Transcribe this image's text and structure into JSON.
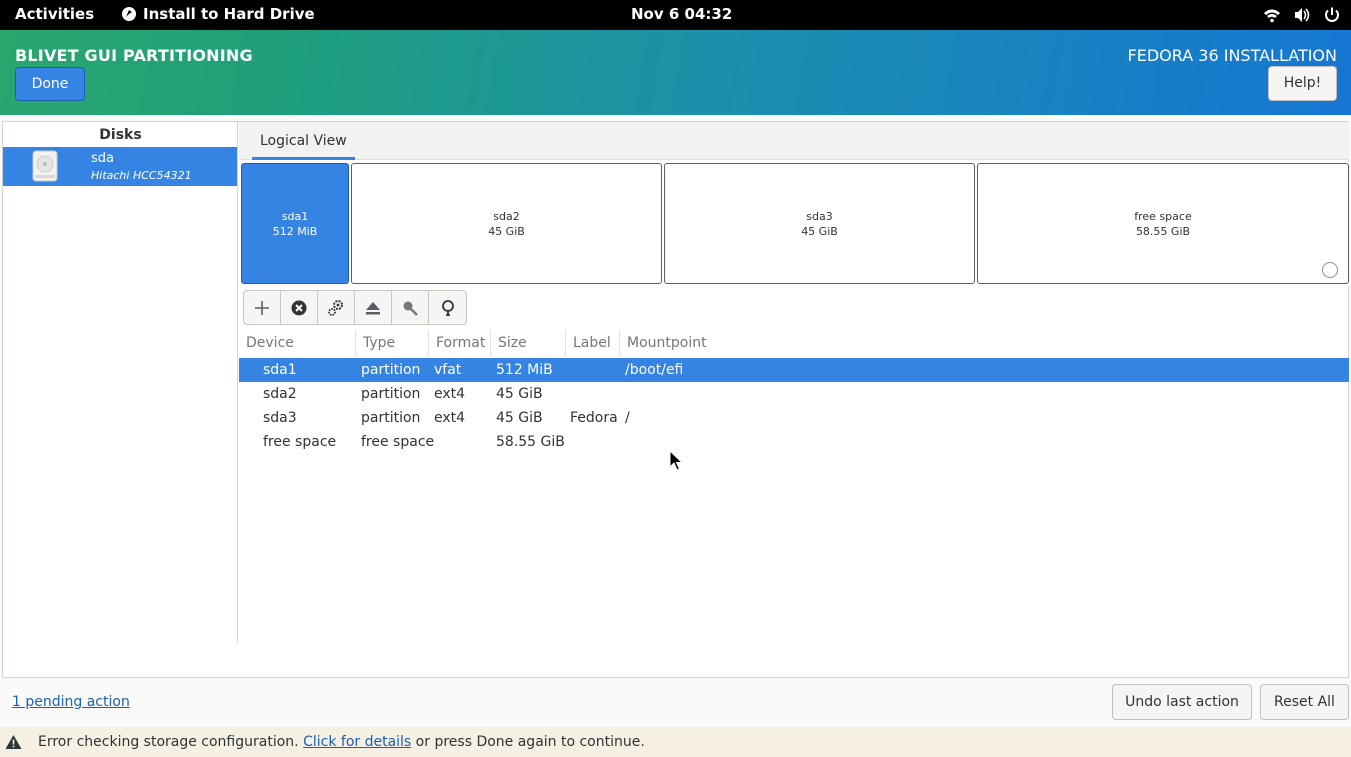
{
  "topbar": {
    "activities": "Activities",
    "app_name": "Install to Hard Drive",
    "clock": "Nov 6  04:32"
  },
  "header": {
    "spoke_title": "BLIVET GUI PARTITIONING",
    "install_title": "FEDORA 36 INSTALLATION",
    "done_label": "Done",
    "help_label": "Help!"
  },
  "disks": {
    "title": "Disks",
    "items": [
      {
        "name": "sda",
        "model": "Hitachi HCC54321"
      }
    ]
  },
  "view": {
    "tab_label": "Logical View"
  },
  "blocks": [
    {
      "name": "sda1",
      "size": "512 MiB",
      "selected": true
    },
    {
      "name": "sda2",
      "size": "45 GiB"
    },
    {
      "name": "sda3",
      "size": "45 GiB"
    },
    {
      "name": "free space",
      "size": "58.55 GiB"
    }
  ],
  "toolbar_icons": [
    "add-icon",
    "delete-icon",
    "configure-icon",
    "unmount-icon",
    "decrypt-icon",
    "info-icon"
  ],
  "table": {
    "columns": [
      "Device",
      "Type",
      "Format",
      "Size",
      "Label",
      "Mountpoint"
    ],
    "rows": [
      [
        "sda1",
        "partition",
        "vfat",
        "512 MiB",
        "",
        "/boot/efi"
      ],
      [
        "sda2",
        "partition",
        "ext4",
        "45 GiB",
        "",
        ""
      ],
      [
        "sda3",
        "partition",
        "ext4",
        "45 GiB",
        "Fedora",
        "/"
      ],
      [
        "free space",
        "free space",
        "",
        "58.55 GiB",
        "",
        ""
      ]
    ],
    "selected_row": 0
  },
  "actions": {
    "pending": "1 pending action",
    "undo": "Undo last action",
    "reset": "Reset All"
  },
  "status": {
    "pre": "Error checking storage configuration. ",
    "link": "Click for details",
    "post": " or press Done again to continue."
  },
  "colors": {
    "accent": "#3584e4",
    "link": "#1a5fb4",
    "status_bg": "#f5efe4"
  }
}
